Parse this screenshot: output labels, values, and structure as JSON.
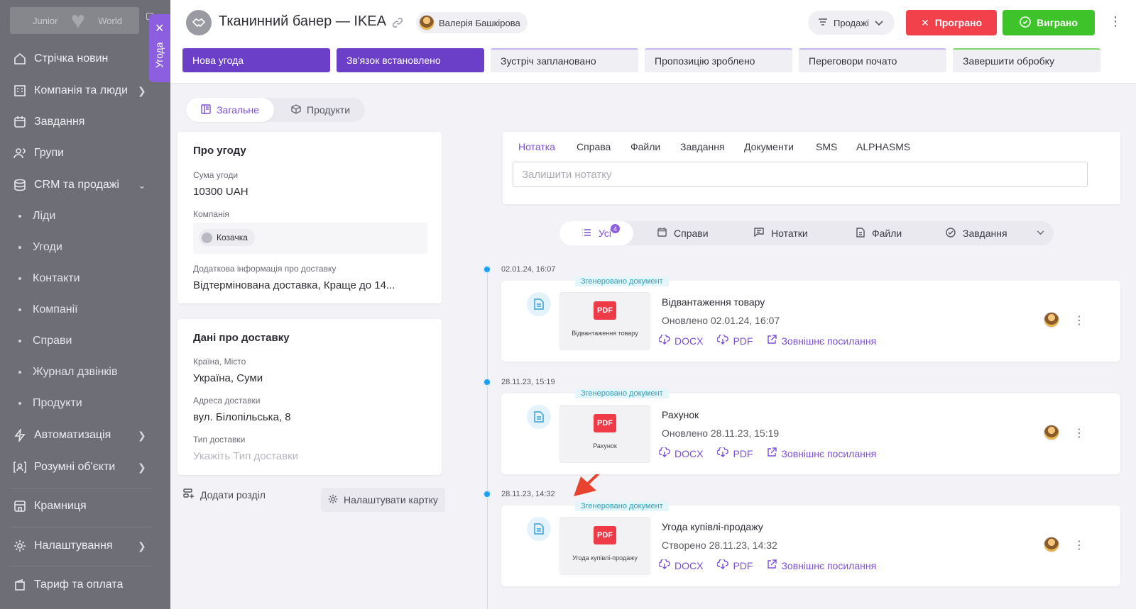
{
  "sidebar": {
    "logo": {
      "left": "Junior",
      "right": "World"
    },
    "items": [
      {
        "label": "Стрічка новин",
        "icon": "home-icon",
        "chevron": false
      },
      {
        "label": "Компанія та люди",
        "icon": "building-icon",
        "chevron": true
      },
      {
        "label": "Завдання",
        "icon": "calendar-icon",
        "chevron": false
      },
      {
        "label": "Групи",
        "icon": "users-icon",
        "chevron": false
      },
      {
        "label": "CRM та продажі",
        "icon": "database-icon",
        "chevron": true
      }
    ],
    "subitems": [
      "Ліди",
      "Угоди",
      "Контакти",
      "Компанії",
      "Справи",
      "Журнал дзвінків",
      "Продукти"
    ],
    "items2": [
      {
        "label": "Автоматизація",
        "icon": "bolt-icon"
      },
      {
        "label": "Розумні об'єкти",
        "icon": "smart-object-icon"
      },
      {
        "label": "Крамниця",
        "icon": "store-icon"
      },
      {
        "label": "Налаштування",
        "icon": "gear-icon"
      },
      {
        "label": "Тариф та оплата",
        "icon": "wallet-icon"
      }
    ]
  },
  "drawer_tab": {
    "label": "Угода"
  },
  "header": {
    "title": "Тканинний банер — IKEA",
    "owner": "Валерія Башкірова",
    "pipeline": "Продажі",
    "lost_label": "Програно",
    "won_label": "Виграно"
  },
  "stages": [
    {
      "label": "Нова угода",
      "state": "done"
    },
    {
      "label": "Зв'язок встановлено",
      "state": "done"
    },
    {
      "label": "Зустріч заплановано",
      "state": "todo"
    },
    {
      "label": "Пропозицію зроблено",
      "state": "todo"
    },
    {
      "label": "Переговори почато",
      "state": "todo"
    },
    {
      "label": "Завершити обробку",
      "state": "last"
    }
  ],
  "subtabs": {
    "general": "Загальне",
    "products": "Продукти"
  },
  "about": {
    "title": "Про угоду",
    "amount_label": "Сума угоди",
    "amount": "10300 UAH",
    "company_label": "Компанія",
    "company": "Козачка",
    "extra_label": "Додаткова інформація про доставку",
    "extra": "Відтермінована доставка, Краще до 14..."
  },
  "delivery": {
    "title": "Дані про доставку",
    "city_label": "Країна, Місто",
    "city": "Україна, Суми",
    "address_label": "Адреса доставки",
    "address": "вул. Білопільська, 8",
    "type_label": "Тип доставки",
    "type_placeholder": "Укажіть Тип доставки"
  },
  "actions": {
    "add_section": "Додати розділ",
    "configure": "Налаштувати картку"
  },
  "composer": {
    "tabs": [
      "Нотатка",
      "Справа",
      "Файли",
      "Завдання",
      "Документи",
      "SMS",
      "ALPHASMS"
    ],
    "placeholder": "Залишити нотатку"
  },
  "filters": {
    "all": "Усі",
    "count": "4",
    "cases": "Справи",
    "notes": "Нотатки",
    "files": "Файли",
    "tasks": "Завдання"
  },
  "timeline": [
    {
      "date": "02.01.24, 16:07",
      "tag": "Згенеровано документ",
      "title": "Відвантаження товару",
      "meta": "Оновлено 02.01.24, 16:07",
      "thumb": "Відвантаження товару"
    },
    {
      "date": "28.11.23, 15:19",
      "tag": "Згенеровано документ",
      "title": "Рахунок",
      "meta": "Оновлено 28.11.23, 15:19",
      "thumb": "Рахунок"
    },
    {
      "date": "28.11.23, 14:32",
      "tag": "Згенеровано документ",
      "title": "Угода купівлі-продажу",
      "meta": "Створено 28.11.23, 14:32",
      "thumb": "Угода купівлі-продажу"
    }
  ],
  "doc_links": {
    "docx": "DOCX",
    "pdf": "PDF",
    "external": "Зовнішнє посилання",
    "pdf_badge": "PDF"
  },
  "colors": {
    "accent": "#7b4fd8",
    "stage_done": "#6b3fc7",
    "lost": "#f2414b",
    "won": "#3ec42a",
    "timeline_dot": "#1e9ff2",
    "annotation_arrow": "#e8432e"
  }
}
